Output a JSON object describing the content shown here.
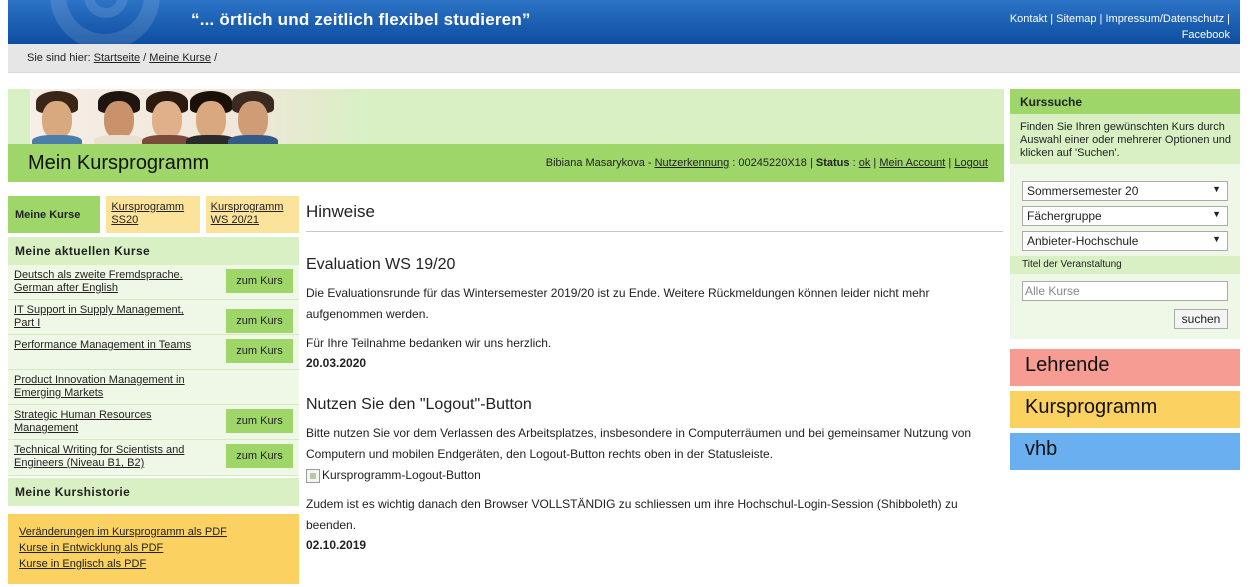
{
  "header": {
    "slogan": "“... örtlich und zeitlich flexibel studieren”",
    "links": [
      "Kontakt",
      "Sitemap",
      "Impressum/Datenschutz",
      "Facebook"
    ]
  },
  "breadcrumb": {
    "prefix": "Sie sind hier:",
    "items": [
      "Startseite",
      "Meine Kurse"
    ]
  },
  "banner": {
    "title": "Mein Kursprogramm",
    "user_name": "Bibiana Masarykova -",
    "id_label": "Nutzerkennung",
    "id_value": ": 00245220X18 |",
    "status_label": "Status",
    "status_sep": ":",
    "status_value": "ok",
    "account_link": "Mein Account",
    "logout_link": "Logout"
  },
  "tabs": {
    "active": "Meine Kurse",
    "ss20": "Kursprogramm SS20",
    "ws2021": "Kursprogramm WS 20/21"
  },
  "current_courses": {
    "heading": "Meine aktuellen Kurse",
    "button_label": "zum Kurs",
    "items": [
      {
        "name": "Deutsch als zweite Fremdsprache. German after English",
        "has_button": true
      },
      {
        "name": "IT Support in Supply Management, Part I",
        "has_button": true
      },
      {
        "name": "Performance Management in Teams",
        "has_button": true
      },
      {
        "name": "Product Innovation Management in Emerging Markets",
        "has_button": false
      },
      {
        "name": "Strategic Human Resources Management",
        "has_button": true
      },
      {
        "name": "Technical Writing for Scientists and Engineers (Niveau B1, B2)",
        "has_button": true
      }
    ]
  },
  "history": {
    "heading": "Meine Kurshistorie",
    "links": [
      "Veränderungen im Kursprogramm als PDF",
      "Kurse in Entwicklung als PDF",
      "Kurse in Englisch als PDF"
    ]
  },
  "main": {
    "title": "Hinweise",
    "notes": [
      {
        "heading": "Evaluation WS 19/20",
        "para1": "Die Evaluationsrunde für das Wintersemester 2019/20 ist zu Ende. Weitere Rückmeldungen können leider nicht mehr aufgenommen werden.",
        "para2": "Für Ihre Teilnahme bedanken wir uns herzlich.",
        "date": "20.03.2020"
      },
      {
        "heading": "Nutzen Sie den \"Logout\"-Button",
        "para1": "Bitte nutzen Sie vor dem Verlassen des Arbeitsplatzes, insbesondere in Computerräumen und bei gemeinsamer Nutzung von Computern und mobilen Endgeräten, den Logout-Button rechts oben in der Statusleiste.",
        "image_alt": "Kursprogramm-Logout-Button",
        "para2": "Zudem ist es wichtig danach den Browser VOLLSTÄNDIG zu schliessen um ihre Hochschul-Login-Session (Shibboleth) zu beenden.",
        "date": "02.10.2019"
      }
    ]
  },
  "search": {
    "heading": "Kurssuche",
    "description": "Finden Sie Ihren gewünschten Kurs durch Auswahl einer oder mehrerer Optionen und klicken auf 'Suchen'.",
    "semester": "Sommersemester 20",
    "subject_group": "Fächergruppe",
    "provider": "Anbieter-Hochschule",
    "title_label": "Titel der Veranstaltung",
    "title_placeholder": "Alle Kurse",
    "button": "suchen"
  },
  "big_buttons": {
    "lehrende": "Lehrende",
    "kursprogramm": "Kursprogramm",
    "vhb": "vhb"
  },
  "colors": {
    "green_dark": "#9fd66a",
    "green_light": "#d8f0c4",
    "yellow": "#fbd161",
    "red": "#f69c92",
    "blue": "#6ab0f0",
    "header_blue": "#1a5fb3"
  }
}
